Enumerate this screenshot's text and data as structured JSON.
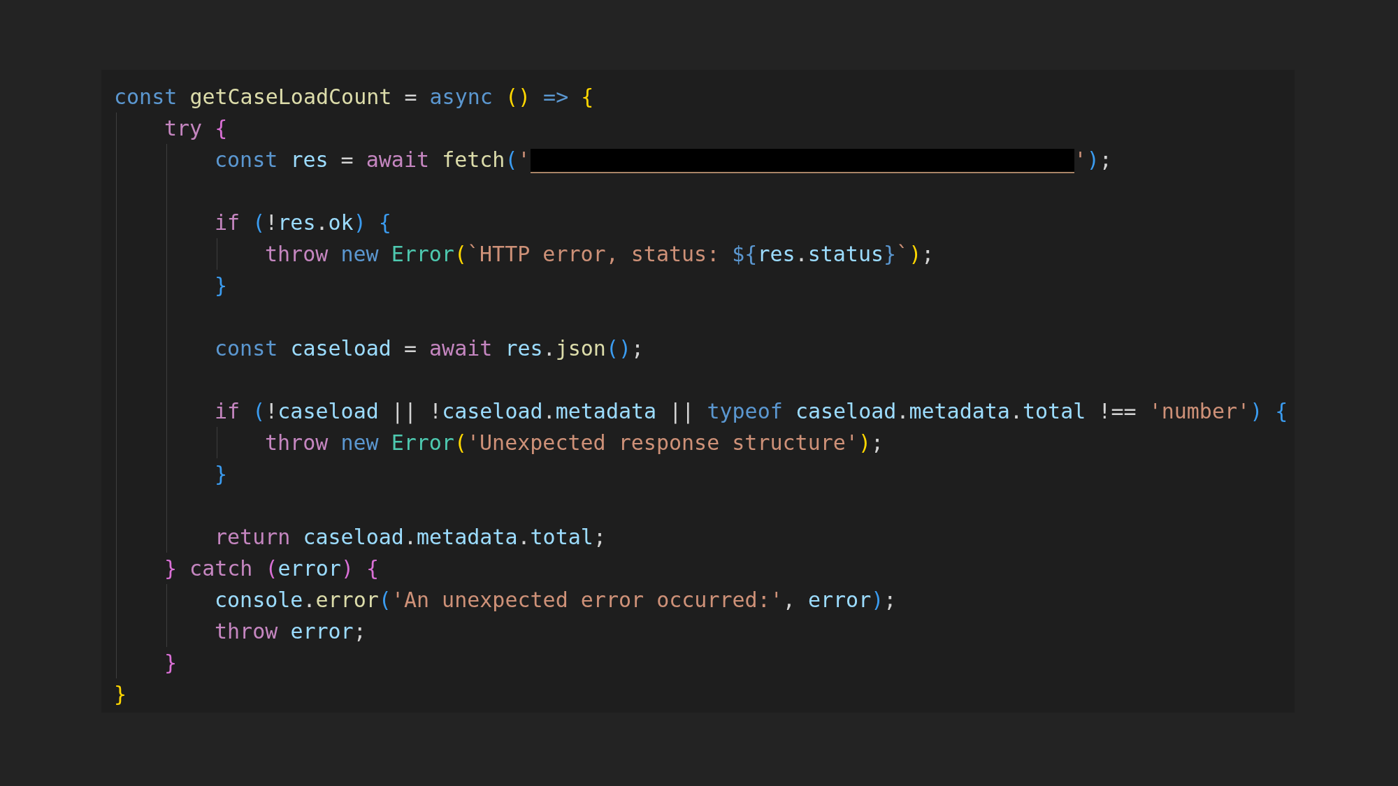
{
  "code_lines": [
    {
      "kind": "code",
      "tokens": [
        {
          "kind": "kw",
          "text": "const "
        },
        {
          "kind": "fn",
          "text": "getCaseLoadCount"
        },
        {
          "kind": "op",
          "text": " = "
        },
        {
          "kind": "kw",
          "text": "async "
        },
        {
          "kind": "b1",
          "text": "()"
        },
        {
          "kind": "kw",
          "text": " => "
        },
        {
          "kind": "b1",
          "text": "{"
        }
      ],
      "children": [
        {
          "kind": "code",
          "tokens": [
            {
              "kind": "ctl",
              "text": "try "
            },
            {
              "kind": "b2",
              "text": "{"
            }
          ],
          "children": [
            {
              "kind": "code",
              "tokens": [
                {
                  "kind": "kw",
                  "text": "const "
                },
                {
                  "kind": "var",
                  "text": "res"
                },
                {
                  "kind": "op",
                  "text": " = "
                },
                {
                  "kind": "ctl",
                  "text": "await "
                },
                {
                  "kind": "fn",
                  "text": "fetch"
                },
                {
                  "kind": "b3",
                  "text": "("
                },
                {
                  "kind": "str",
                  "text": "'"
                },
                {
                  "kind": "redacted"
                },
                {
                  "kind": "str",
                  "text": "'"
                },
                {
                  "kind": "b3",
                  "text": ")"
                },
                {
                  "kind": "op",
                  "text": ";"
                }
              ]
            },
            {
              "kind": "blank"
            },
            {
              "kind": "code",
              "tokens": [
                {
                  "kind": "ctl",
                  "text": "if "
                },
                {
                  "kind": "b3",
                  "text": "("
                },
                {
                  "kind": "op",
                  "text": "!"
                },
                {
                  "kind": "var",
                  "text": "res"
                },
                {
                  "kind": "op",
                  "text": "."
                },
                {
                  "kind": "var",
                  "text": "ok"
                },
                {
                  "kind": "b3",
                  "text": ") {"
                }
              ],
              "children": [
                {
                  "kind": "code",
                  "tokens": [
                    {
                      "kind": "ctl",
                      "text": "throw "
                    },
                    {
                      "kind": "kw",
                      "text": "new "
                    },
                    {
                      "kind": "cls",
                      "text": "Error"
                    },
                    {
                      "kind": "b1",
                      "text": "("
                    },
                    {
                      "kind": "str",
                      "text": "`HTTP error, status: "
                    },
                    {
                      "kind": "kw",
                      "text": "${"
                    },
                    {
                      "kind": "var",
                      "text": "res"
                    },
                    {
                      "kind": "op",
                      "text": "."
                    },
                    {
                      "kind": "var",
                      "text": "status"
                    },
                    {
                      "kind": "kw",
                      "text": "}"
                    },
                    {
                      "kind": "str",
                      "text": "`"
                    },
                    {
                      "kind": "b1",
                      "text": ")"
                    },
                    {
                      "kind": "op",
                      "text": ";"
                    }
                  ]
                }
              ]
            },
            {
              "kind": "code",
              "tokens": [
                {
                  "kind": "b3",
                  "text": "}"
                }
              ]
            },
            {
              "kind": "blank"
            },
            {
              "kind": "code",
              "tokens": [
                {
                  "kind": "kw",
                  "text": "const "
                },
                {
                  "kind": "var",
                  "text": "caseload"
                },
                {
                  "kind": "op",
                  "text": " = "
                },
                {
                  "kind": "ctl",
                  "text": "await "
                },
                {
                  "kind": "var",
                  "text": "res"
                },
                {
                  "kind": "op",
                  "text": "."
                },
                {
                  "kind": "fn",
                  "text": "json"
                },
                {
                  "kind": "b3",
                  "text": "()"
                },
                {
                  "kind": "op",
                  "text": ";"
                }
              ]
            },
            {
              "kind": "blank"
            },
            {
              "kind": "code",
              "tokens": [
                {
                  "kind": "ctl",
                  "text": "if "
                },
                {
                  "kind": "b3",
                  "text": "("
                },
                {
                  "kind": "op",
                  "text": "!"
                },
                {
                  "kind": "var",
                  "text": "caseload"
                },
                {
                  "kind": "op",
                  "text": " || !"
                },
                {
                  "kind": "var",
                  "text": "caseload"
                },
                {
                  "kind": "op",
                  "text": "."
                },
                {
                  "kind": "var",
                  "text": "metadata"
                },
                {
                  "kind": "op",
                  "text": " || "
                },
                {
                  "kind": "kw",
                  "text": "typeof "
                },
                {
                  "kind": "var",
                  "text": "caseload"
                },
                {
                  "kind": "op",
                  "text": "."
                },
                {
                  "kind": "var",
                  "text": "metadata"
                },
                {
                  "kind": "op",
                  "text": "."
                },
                {
                  "kind": "var",
                  "text": "total"
                },
                {
                  "kind": "op",
                  "text": " !== "
                },
                {
                  "kind": "str",
                  "text": "'number'"
                },
                {
                  "kind": "b3",
                  "text": ") {"
                }
              ],
              "children": [
                {
                  "kind": "code",
                  "tokens": [
                    {
                      "kind": "ctl",
                      "text": "throw "
                    },
                    {
                      "kind": "kw",
                      "text": "new "
                    },
                    {
                      "kind": "cls",
                      "text": "Error"
                    },
                    {
                      "kind": "b1",
                      "text": "("
                    },
                    {
                      "kind": "str",
                      "text": "'Unexpected response structure'"
                    },
                    {
                      "kind": "b1",
                      "text": ")"
                    },
                    {
                      "kind": "op",
                      "text": ";"
                    }
                  ]
                }
              ]
            },
            {
              "kind": "code",
              "tokens": [
                {
                  "kind": "b3",
                  "text": "}"
                }
              ]
            },
            {
              "kind": "blank"
            },
            {
              "kind": "code",
              "tokens": [
                {
                  "kind": "ctl",
                  "text": "return "
                },
                {
                  "kind": "var",
                  "text": "caseload"
                },
                {
                  "kind": "op",
                  "text": "."
                },
                {
                  "kind": "var",
                  "text": "metadata"
                },
                {
                  "kind": "op",
                  "text": "."
                },
                {
                  "kind": "var",
                  "text": "total"
                },
                {
                  "kind": "op",
                  "text": ";"
                }
              ]
            }
          ]
        },
        {
          "kind": "code",
          "tokens": [
            {
              "kind": "b2",
              "text": "}"
            },
            {
              "kind": "ctl",
              "text": " catch "
            },
            {
              "kind": "b2",
              "text": "("
            },
            {
              "kind": "var",
              "text": "error"
            },
            {
              "kind": "b2",
              "text": ") {"
            }
          ],
          "children": [
            {
              "kind": "code",
              "tokens": [
                {
                  "kind": "var",
                  "text": "console"
                },
                {
                  "kind": "op",
                  "text": "."
                },
                {
                  "kind": "fn",
                  "text": "error"
                },
                {
                  "kind": "b3",
                  "text": "("
                },
                {
                  "kind": "str",
                  "text": "'An unexpected error occurred:'"
                },
                {
                  "kind": "op",
                  "text": ", "
                },
                {
                  "kind": "var",
                  "text": "error"
                },
                {
                  "kind": "b3",
                  "text": ")"
                },
                {
                  "kind": "op",
                  "text": ";"
                }
              ]
            },
            {
              "kind": "code",
              "tokens": [
                {
                  "kind": "ctl",
                  "text": "throw "
                },
                {
                  "kind": "var",
                  "text": "error"
                },
                {
                  "kind": "op",
                  "text": ";"
                }
              ]
            }
          ]
        },
        {
          "kind": "code",
          "tokens": [
            {
              "kind": "b2",
              "text": "}"
            }
          ]
        }
      ]
    },
    {
      "kind": "code",
      "tokens": [
        {
          "kind": "b1",
          "text": "}"
        }
      ]
    }
  ]
}
